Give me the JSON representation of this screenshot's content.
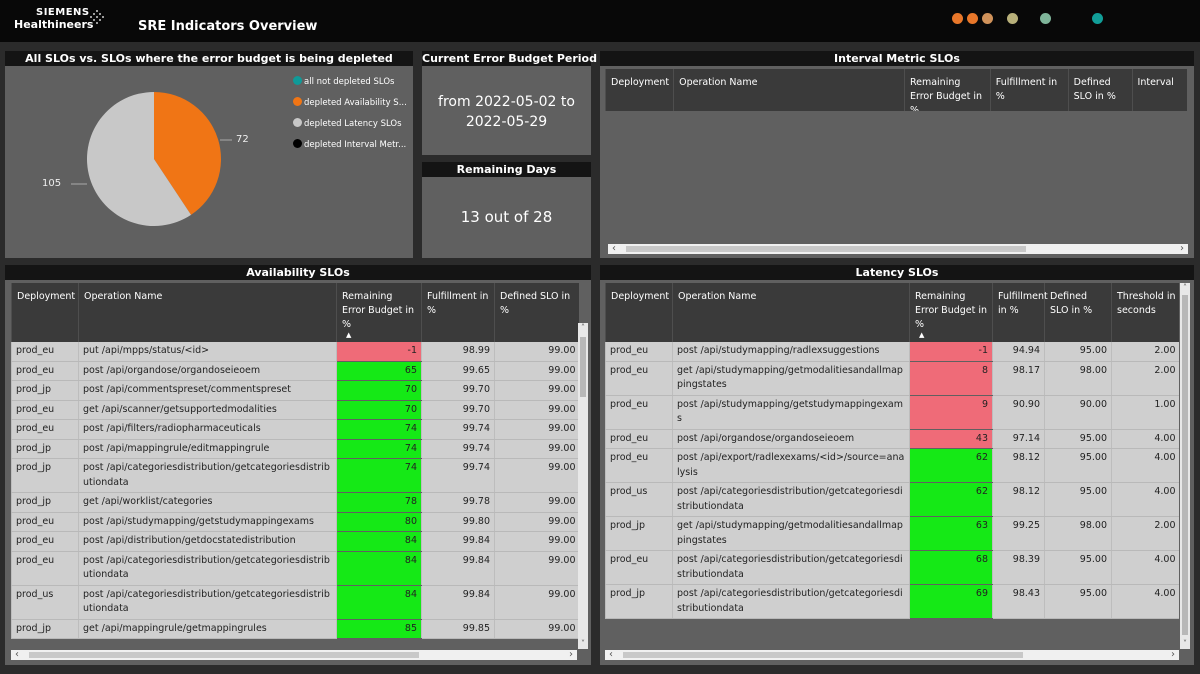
{
  "header": {
    "brand_line1": "SIEMENS",
    "brand_line2": "Healthineers",
    "title": "SRE Indicators Overview",
    "status_dots": [
      "#e8772a",
      "#e8772a",
      "#d0925a",
      "#b8b07a",
      "#7fb59a",
      "#119e98"
    ]
  },
  "pie_panel": {
    "title": "All SLOs vs. SLOs where the error budget is being depleted",
    "legend": [
      {
        "label": "all not depleted SLOs",
        "color": "#0f9a98"
      },
      {
        "label": "depleted Availability S...",
        "color": "#f07515"
      },
      {
        "label": "depleted Latency SLOs",
        "color": "#c8c8c8"
      },
      {
        "label": "depleted Interval Metr...",
        "color": "#000000"
      }
    ],
    "label_orange": "72",
    "label_grey": "105"
  },
  "chart_data": {
    "type": "pie",
    "title": "All SLOs vs. SLOs where the error budget is being depleted",
    "slices": [
      {
        "name": "depleted Availability S...",
        "value": 72,
        "color": "#f07515"
      },
      {
        "name": "depleted Latency SLOs",
        "value": 105,
        "color": "#c8c8c8"
      }
    ],
    "legend_position": "right"
  },
  "period_panel": {
    "title": "Current Error Budget Period",
    "line1": "from 2022-05-02 to",
    "line2": "2022-05-29"
  },
  "days_panel": {
    "title": "Remaining Days",
    "value": "13 out of 28"
  },
  "interval_panel": {
    "title": "Interval Metric SLOs",
    "headers": [
      "Deployment",
      "Operation Name",
      "Remaining Error Budget in %",
      "Fulfillment in %",
      "Defined SLO in %",
      "Interval"
    ]
  },
  "availability": {
    "title": "Availability SLOs",
    "headers": [
      "Deployment",
      "Operation Name",
      "Remaining Error Budget in %",
      "Fulfillment in %",
      "Defined SLO in %"
    ],
    "rows": [
      {
        "dep": "prod_eu",
        "op": "put /api/mpps/status/<id>",
        "budget": "-1",
        "status": "red",
        "ful": "98.99",
        "slo": "99.00"
      },
      {
        "dep": "prod_eu",
        "op": "post /api/organdose/organdoseieoem",
        "budget": "65",
        "status": "green",
        "ful": "99.65",
        "slo": "99.00"
      },
      {
        "dep": "prod_jp",
        "op": "post /api/commentspreset/commentspreset",
        "budget": "70",
        "status": "green",
        "ful": "99.70",
        "slo": "99.00"
      },
      {
        "dep": "prod_eu",
        "op": "get /api/scanner/getsupportedmodalities",
        "budget": "70",
        "status": "green",
        "ful": "99.70",
        "slo": "99.00"
      },
      {
        "dep": "prod_eu",
        "op": "post /api/filters/radiopharmaceuticals",
        "budget": "74",
        "status": "green",
        "ful": "99.74",
        "slo": "99.00"
      },
      {
        "dep": "prod_jp",
        "op": "post /api/mappingrule/editmappingrule",
        "budget": "74",
        "status": "green",
        "ful": "99.74",
        "slo": "99.00"
      },
      {
        "dep": "prod_jp",
        "op": "post /api/categoriesdistribution/getcategoriesdistributiondata",
        "budget": "74",
        "status": "green",
        "ful": "99.74",
        "slo": "99.00"
      },
      {
        "dep": "prod_jp",
        "op": "get /api/worklist/categories",
        "budget": "78",
        "status": "green",
        "ful": "99.78",
        "slo": "99.00"
      },
      {
        "dep": "prod_eu",
        "op": "post /api/studymapping/getstudymappingexams",
        "budget": "80",
        "status": "green",
        "ful": "99.80",
        "slo": "99.00"
      },
      {
        "dep": "prod_eu",
        "op": "post /api/distribution/getdocstatedistribution",
        "budget": "84",
        "status": "green",
        "ful": "99.84",
        "slo": "99.00"
      },
      {
        "dep": "prod_eu",
        "op": "post /api/categoriesdistribution/getcategoriesdistributiondata",
        "budget": "84",
        "status": "green",
        "ful": "99.84",
        "slo": "99.00"
      },
      {
        "dep": "prod_us",
        "op": "post /api/categoriesdistribution/getcategoriesdistributiondata",
        "budget": "84",
        "status": "green",
        "ful": "99.84",
        "slo": "99.00"
      },
      {
        "dep": "prod_jp",
        "op": "get /api/mappingrule/getmappingrules",
        "budget": "85",
        "status": "green",
        "ful": "99.85",
        "slo": "99.00"
      }
    ]
  },
  "latency": {
    "title": "Latency SLOs",
    "headers": [
      "Deployment",
      "Operation Name",
      "Remaining Error Budget in %",
      "Fulfillment in %",
      "Defined SLO in %",
      "Threshold in seconds"
    ],
    "rows": [
      {
        "dep": "prod_eu",
        "op": "post /api/studymapping/radlexsuggestions",
        "budget": "-1",
        "status": "red",
        "ful": "94.94",
        "slo": "95.00",
        "thr": "2.00"
      },
      {
        "dep": "prod_eu",
        "op": "get /api/studymapping/getmodalitiesandallmappingstates",
        "budget": "8",
        "status": "red",
        "ful": "98.17",
        "slo": "98.00",
        "thr": "2.00"
      },
      {
        "dep": "prod_eu",
        "op": "post /api/studymapping/getstudymappingexams",
        "budget": "9",
        "status": "red",
        "ful": "90.90",
        "slo": "90.00",
        "thr": "1.00"
      },
      {
        "dep": "prod_eu",
        "op": "post /api/organdose/organdoseieoem",
        "budget": "43",
        "status": "red",
        "ful": "97.14",
        "slo": "95.00",
        "thr": "4.00"
      },
      {
        "dep": "prod_eu",
        "op": "post /api/export/radlexexams/<id>/source=analysis",
        "budget": "62",
        "status": "green",
        "ful": "98.12",
        "slo": "95.00",
        "thr": "4.00"
      },
      {
        "dep": "prod_us",
        "op": "post /api/categoriesdistribution/getcategoriesdistributiondata",
        "budget": "62",
        "status": "green",
        "ful": "98.12",
        "slo": "95.00",
        "thr": "4.00"
      },
      {
        "dep": "prod_jp",
        "op": "get /api/studymapping/getmodalitiesandallmappingstates",
        "budget": "63",
        "status": "green",
        "ful": "99.25",
        "slo": "98.00",
        "thr": "2.00"
      },
      {
        "dep": "prod_eu",
        "op": "post /api/categoriesdistribution/getcategoriesdistributiondata",
        "budget": "68",
        "status": "green",
        "ful": "98.39",
        "slo": "95.00",
        "thr": "4.00"
      },
      {
        "dep": "prod_jp",
        "op": "post /api/categoriesdistribution/getcategoriesdistributiondata",
        "budget": "69",
        "status": "green",
        "ful": "98.43",
        "slo": "95.00",
        "thr": "4.00"
      }
    ]
  }
}
